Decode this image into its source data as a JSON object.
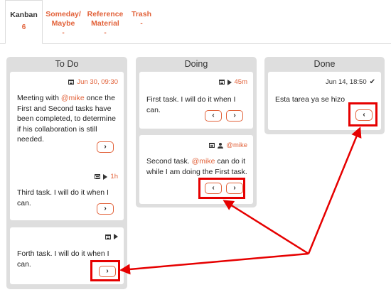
{
  "tabs": [
    {
      "label": "Kanban",
      "count": "6"
    },
    {
      "label": "Someday/ Maybe",
      "count": "-"
    },
    {
      "label": "Reference Material",
      "count": "-"
    },
    {
      "label": "Trash",
      "count": "-"
    }
  ],
  "columns": {
    "todo": {
      "title": "To Do",
      "cards": [
        {
          "meta": "Jun 30, 09:30",
          "text_before": "Meeting with ",
          "mention": "@mike",
          "text_after": " once the First and Second tasks have been completed, to determine if his collaboration is still needed.",
          "next": "›"
        },
        {
          "meta": "1h",
          "text": "Third task. I will do it when I can.",
          "next": "›"
        },
        {
          "text": "Forth task. I will do it when I can.",
          "next": "›"
        }
      ]
    },
    "doing": {
      "title": "Doing",
      "cards": [
        {
          "meta": "45m",
          "text": "First task. I will do it when I can.",
          "prev": "‹",
          "next": "›"
        },
        {
          "meta": "@mike",
          "text_before": "Second task. ",
          "mention": "@mike",
          "text_after": " can do it while I am doing the First task.",
          "prev": "‹",
          "next": "›"
        }
      ]
    },
    "done": {
      "title": "Done",
      "cards": [
        {
          "meta": "Jun 14, 18:50",
          "text": "Esta tarea ya se hizo",
          "prev": "‹"
        }
      ]
    }
  },
  "colors": {
    "accent": "#e2623a",
    "highlight": "#e60000",
    "column_bg": "#dedede"
  },
  "icons": [
    "calendar-icon",
    "play-icon",
    "user-icon",
    "check-icon"
  ]
}
